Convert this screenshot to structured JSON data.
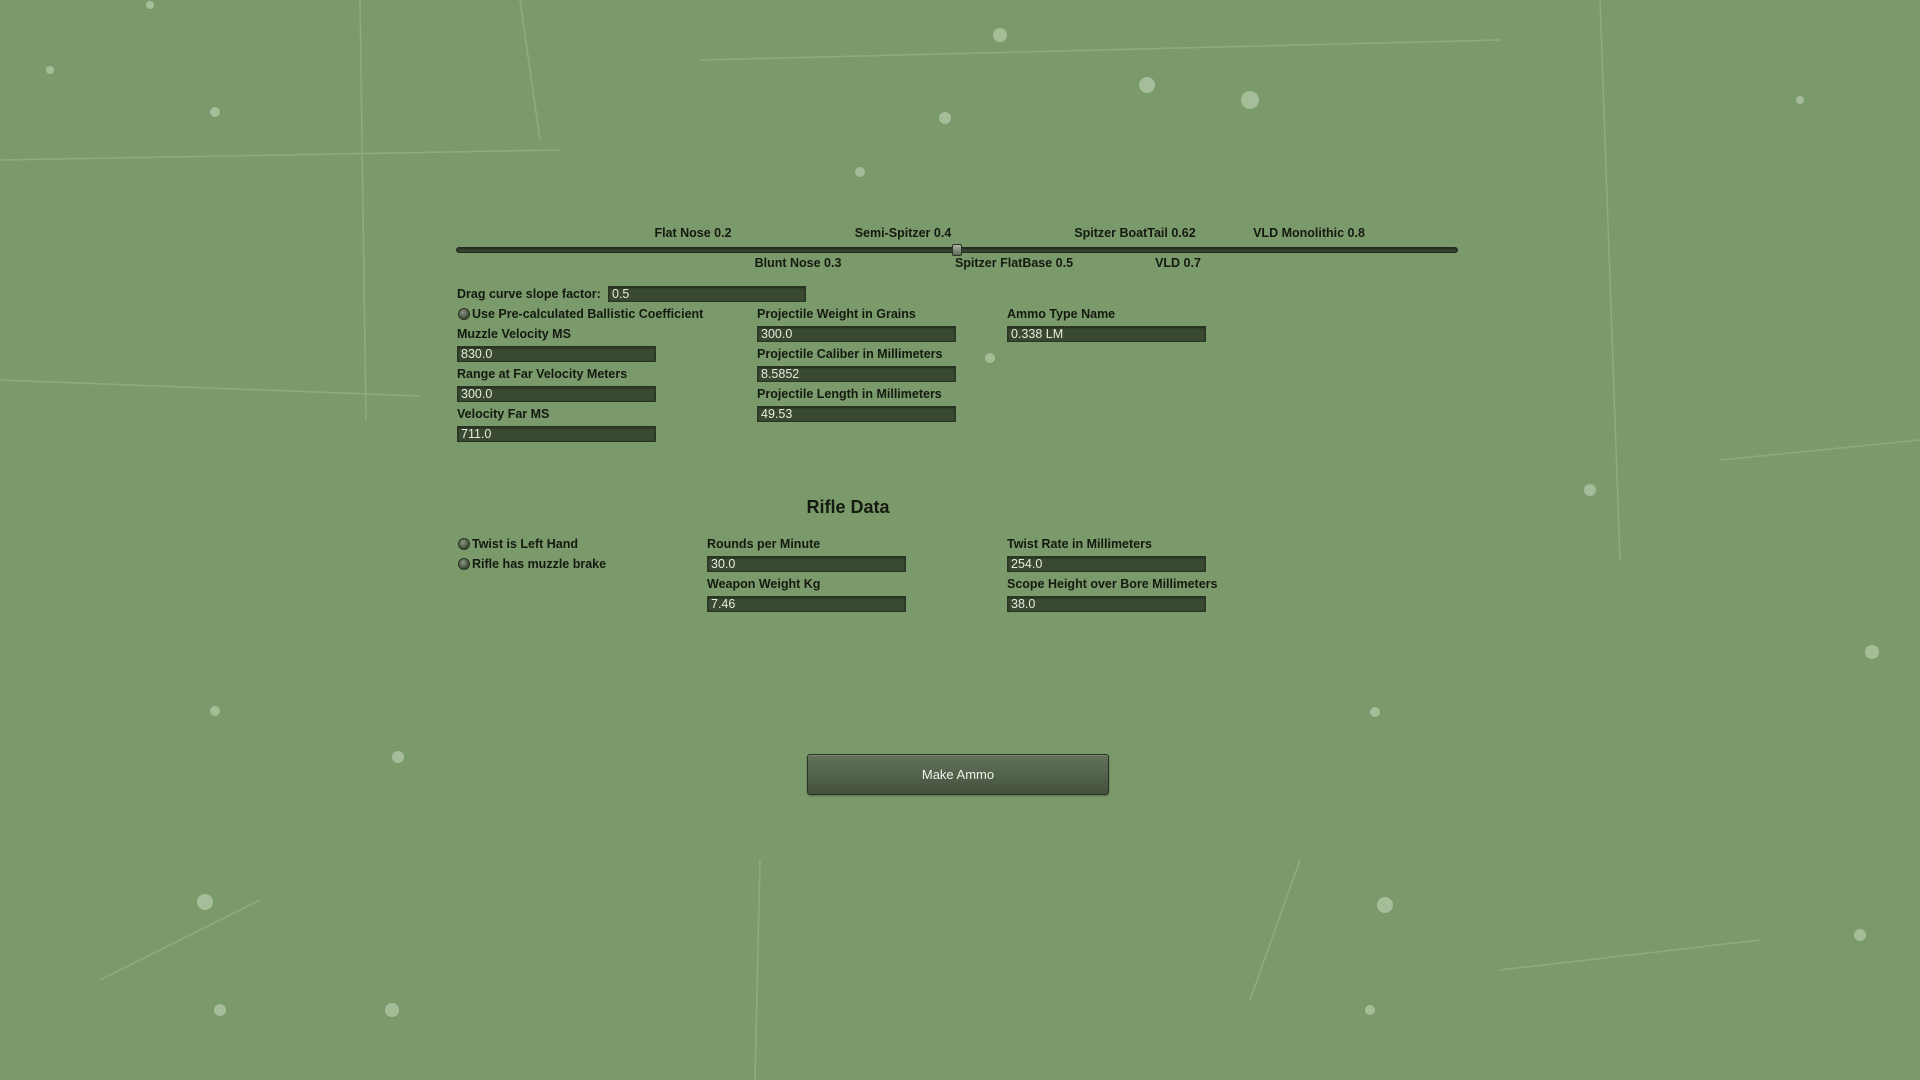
{
  "colors": {
    "background": "#7b9a6b",
    "field_bg": "#3a4a32",
    "field_text": "#e6ecdf",
    "label_text": "#141a10",
    "button_bg": "#54634c"
  },
  "nose_slider": {
    "value": 0.5,
    "min": 0.0,
    "max": 1.0,
    "labels_top": [
      "Flat Nose 0.2",
      "Semi-Spitzer 0.4",
      "Spitzer BoatTail 0.62",
      "VLD Monolithic 0.8"
    ],
    "labels_bottom": [
      "Blunt Nose 0.3",
      "Spitzer FlatBase 0.5",
      "VLD 0.7"
    ]
  },
  "drag": {
    "label": "Drag curve slope factor:",
    "value": "0.5"
  },
  "ammo": {
    "use_bc_label": "Use Pre-calculated Ballistic Coefficient",
    "muzzle_velocity_label": "Muzzle Velocity MS",
    "muzzle_velocity": "830.0",
    "range_far_label": "Range at Far Velocity Meters",
    "range_far": "300.0",
    "velocity_far_label": "Velocity Far MS",
    "velocity_far": "711.0",
    "weight_label": "Projectile Weight in Grains",
    "weight": "300.0",
    "caliber_label": "Projectile Caliber in Millimeters",
    "caliber": "8.5852",
    "length_label": "Projectile Length in Millimeters",
    "length": "49.53",
    "name_label": "Ammo Type Name",
    "name": "0.338 LM"
  },
  "rifle": {
    "heading": "Rifle Data",
    "twist_left_label": "Twist is Left Hand",
    "muzzle_brake_label": "Rifle has muzzle brake",
    "rpm_label": "Rounds per Minute",
    "rpm": "30.0",
    "weight_label": "Weapon Weight Kg",
    "weight": "7.46",
    "twist_rate_label": "Twist Rate in Millimeters",
    "twist_rate": "254.0",
    "scope_height_label": "Scope Height over Bore Millimeters",
    "scope_height": "38.0"
  },
  "make_button_label": "Make Ammo"
}
